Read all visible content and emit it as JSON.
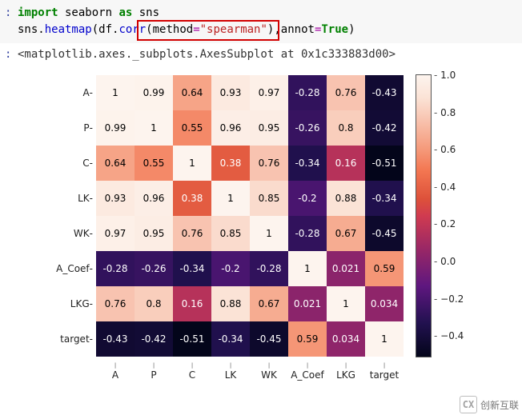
{
  "code": {
    "line1_kw_import": "import",
    "line1_mod": " seaborn ",
    "line1_kw_as": "as",
    "line1_alias": " sns",
    "line2_pre": "sns.",
    "line2_heatmap": "heatmap",
    "line2_open": "(df.",
    "line2_corr": "corr",
    "line2_p1": "(method",
    "line2_eq1": "=",
    "line2_str": "\"spearman\"",
    "line2_p2": "),annot",
    "line2_eq2": "=",
    "line2_true": "True",
    "line2_close": ")"
  },
  "output_text": "<matplotlib.axes._subplots.AxesSubplot at 0x1c333883d00>",
  "chart_data": {
    "type": "heatmap",
    "labels": [
      "A",
      "P",
      "C",
      "LK",
      "WK",
      "A_Coef",
      "LKG",
      "target"
    ],
    "matrix": [
      [
        1,
        0.99,
        0.64,
        0.93,
        0.97,
        -0.28,
        0.76,
        -0.43
      ],
      [
        0.99,
        1,
        0.55,
        0.96,
        0.95,
        -0.26,
        0.8,
        -0.42
      ],
      [
        0.64,
        0.55,
        1,
        0.38,
        0.76,
        -0.34,
        0.16,
        -0.51
      ],
      [
        0.93,
        0.96,
        0.38,
        1,
        0.85,
        -0.2,
        0.88,
        -0.34
      ],
      [
        0.97,
        0.95,
        0.76,
        0.85,
        1,
        -0.28,
        0.67,
        -0.45
      ],
      [
        -0.28,
        -0.26,
        -0.34,
        -0.2,
        -0.28,
        1,
        0.021,
        0.59
      ],
      [
        0.76,
        0.8,
        0.16,
        0.88,
        0.67,
        0.021,
        1,
        0.034
      ],
      [
        -0.43,
        -0.42,
        -0.51,
        -0.34,
        -0.45,
        0.59,
        0.034,
        1
      ]
    ],
    "annot_text": [
      [
        "1",
        "0.99",
        "0.64",
        "0.93",
        "0.97",
        "-0.28",
        "0.76",
        "-0.43"
      ],
      [
        "0.99",
        "1",
        "0.55",
        "0.96",
        "0.95",
        "-0.26",
        "0.8",
        "-0.42"
      ],
      [
        "0.64",
        "0.55",
        "1",
        "0.38",
        "0.76",
        "-0.34",
        "0.16",
        "-0.51"
      ],
      [
        "0.93",
        "0.96",
        "0.38",
        "1",
        "0.85",
        "-0.2",
        "0.88",
        "-0.34"
      ],
      [
        "0.97",
        "0.95",
        "0.76",
        "0.85",
        "1",
        "-0.28",
        "0.67",
        "-0.45"
      ],
      [
        "-0.28",
        "-0.26",
        "-0.34",
        "-0.2",
        "-0.28",
        "1",
        "0.021",
        "0.59"
      ],
      [
        "0.76",
        "0.8",
        "0.16",
        "0.88",
        "0.67",
        "0.021",
        "1",
        "0.034"
      ],
      [
        "-0.43",
        "-0.42",
        "-0.51",
        "-0.34",
        "-0.45",
        "0.59",
        "0.034",
        "1"
      ]
    ],
    "colorbar_ticks": [
      {
        "label": "1.0",
        "value": 1.0
      },
      {
        "label": "0.8",
        "value": 0.8
      },
      {
        "label": "0.6",
        "value": 0.6
      },
      {
        "label": "0.4",
        "value": 0.4
      },
      {
        "label": "0.2",
        "value": 0.2
      },
      {
        "label": "0.0",
        "value": 0.0
      },
      {
        "label": "−0.2",
        "value": -0.2
      },
      {
        "label": "−0.4",
        "value": -0.4
      }
    ],
    "value_range": [
      -0.51,
      1.0
    ]
  },
  "watermark": {
    "logo_text": "CX",
    "label": "创新互联"
  }
}
